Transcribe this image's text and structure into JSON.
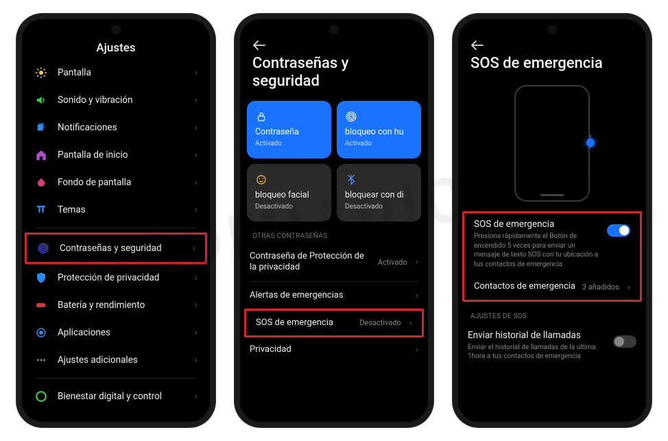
{
  "watermark": "XIAOMIADICTOS",
  "screen1": {
    "title": "Ajustes",
    "items": [
      {
        "label": "Pantalla",
        "icon": "sun-icon",
        "color": "#f7c948"
      },
      {
        "label": "Sonido y vibración",
        "icon": "sound-icon",
        "color": "#3cc84a"
      },
      {
        "label": "Notificaciones",
        "icon": "notification-icon",
        "color": "#2a8bf2"
      },
      {
        "label": "Pantalla de inicio",
        "icon": "home-icon",
        "color": "#b04cc9"
      },
      {
        "label": "Fondo de pantalla",
        "icon": "wallpaper-icon",
        "color": "#d83a75"
      },
      {
        "label": "Temas",
        "icon": "theme-icon",
        "color": "#2a8bf2"
      },
      {
        "label": "Contraseñas y seguridad",
        "icon": "fingerprint-icon",
        "color": "#5558ff",
        "highlight": true
      },
      {
        "label": "Protección de privacidad",
        "icon": "shield-icon",
        "color": "#2a8bf2"
      },
      {
        "label": "Batería y rendimiento",
        "icon": "battery-icon",
        "color": "#d83a3a"
      },
      {
        "label": "Aplicaciones",
        "icon": "apps-icon",
        "color": "#2a8bf2"
      },
      {
        "label": "Ajustes adicionales",
        "icon": "more-icon",
        "color": "#888"
      },
      {
        "label": "Bienestar digital y control",
        "icon": "wellbeing-icon",
        "color": "#3cc84a"
      }
    ]
  },
  "screen2": {
    "title": "Contraseñas y seguridad",
    "cards": [
      {
        "icon": "lock-icon",
        "title": "Contraseña",
        "sub": "Activado",
        "style": "blue"
      },
      {
        "icon": "fingerprint-icon",
        "title": "bloqueo con hu",
        "sub": "Activado",
        "style": "blue"
      },
      {
        "icon": "face-icon",
        "title": "bloqueo facial",
        "sub": "Desactivado",
        "style": "dark"
      },
      {
        "icon": "bluetooth-icon",
        "title": "bloquear con di",
        "sub": "Desactivado",
        "style": "dark"
      }
    ],
    "section_label": "OTRAS CONTRASEÑAS",
    "rows": [
      {
        "label": "Contraseña de Protección de la privacidad",
        "val": "Activado"
      },
      {
        "label": "Alertas de emergencias",
        "val": ""
      },
      {
        "label": "SOS de emergencia",
        "val": "Desactivado",
        "highlight": true
      },
      {
        "label": "Privacidad",
        "val": ""
      }
    ]
  },
  "screen3": {
    "title": "SOS de emergencia",
    "sos_title": "SOS de emergencia",
    "sos_desc": "Presiona rápidamente el Botón de encendido 5 veces para enviar un mensaje de texto SOS con tu ubicación a tus contactos de emergencia",
    "contacts_label": "Contactos de emergencia",
    "contacts_val": "3 añadidos",
    "section_label": "AJUSTES DE SOS",
    "call_title": "Enviar historial de llamadas",
    "call_desc": "Enviar el historial de llamadas de la última 1hora a tus contactos de emergencia"
  }
}
